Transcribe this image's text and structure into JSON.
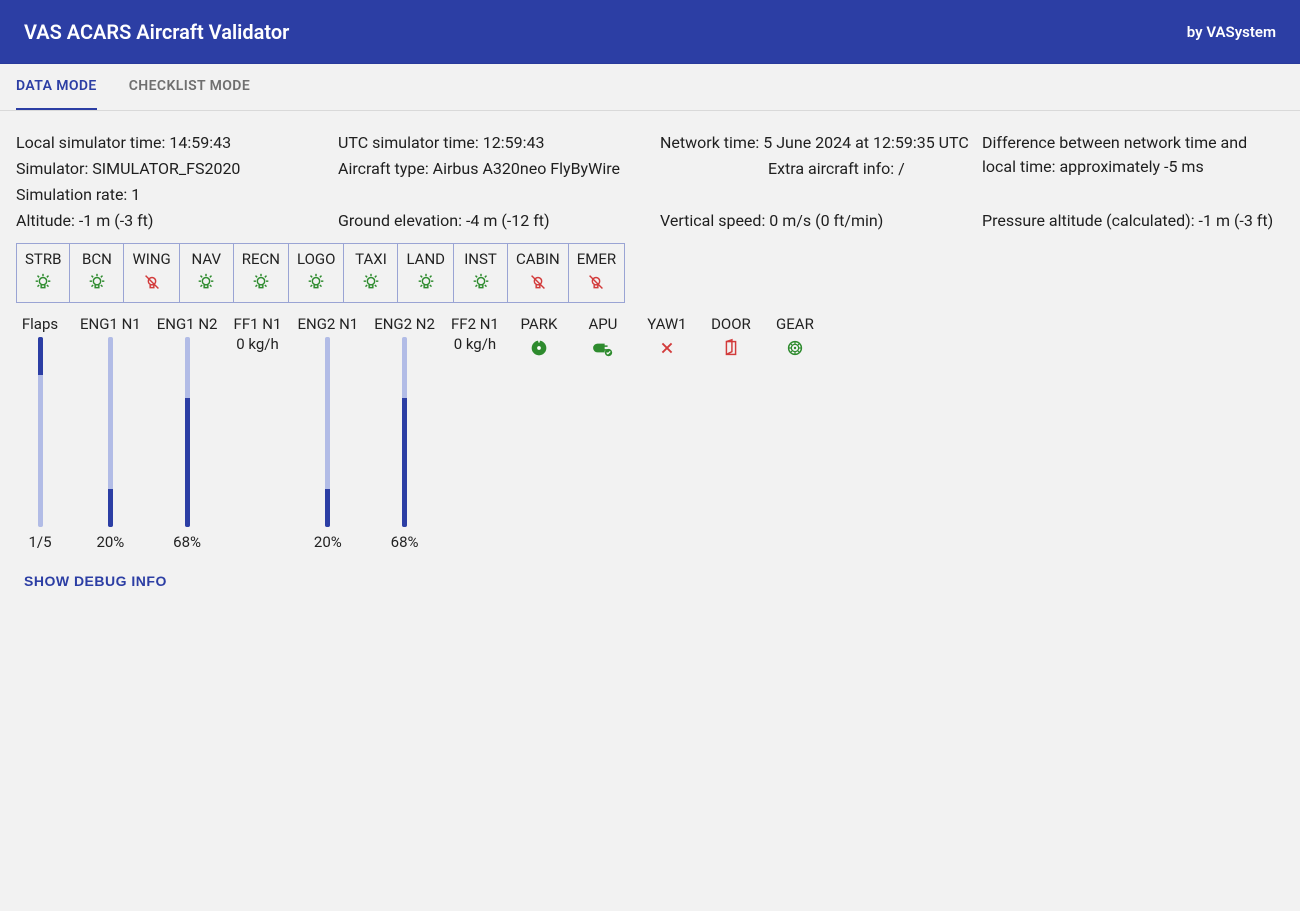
{
  "header": {
    "title": "VAS ACARS Aircraft Validator",
    "byline": "by VASystem"
  },
  "tabs": {
    "data": "DATA MODE",
    "checklist": "CHECKLIST MODE",
    "active": "data"
  },
  "info": {
    "localSimTime": "Local simulator time: 14:59:43",
    "utcSimTime": "UTC simulator time: 12:59:43",
    "networkTime": "Network time: 5 June 2024 at 12:59:35 UTC",
    "timeDiff": "Difference between network time and local time: approximately -5 ms",
    "simulator": "Simulator: SIMULATOR_FS2020",
    "aircraftType": "Aircraft type: Airbus A320neo FlyByWire",
    "extraInfo": "Extra aircraft info: /",
    "simRate": "Simulation rate: 1",
    "altitude": "Altitude: -1 m (-3 ft)",
    "groundElev": "Ground elevation: -4 m (-12 ft)",
    "verticalSpeed": "Vertical speed: 0 m/s (0 ft/min)",
    "pressureAlt": "Pressure altitude (calculated): -1 m (-3 ft)"
  },
  "lights": [
    {
      "name": "STRB",
      "on": true
    },
    {
      "name": "BCN",
      "on": true
    },
    {
      "name": "WING",
      "on": false
    },
    {
      "name": "NAV",
      "on": true
    },
    {
      "name": "RECN",
      "on": true
    },
    {
      "name": "LOGO",
      "on": true
    },
    {
      "name": "TAXI",
      "on": true
    },
    {
      "name": "LAND",
      "on": true
    },
    {
      "name": "INST",
      "on": true
    },
    {
      "name": "CABIN",
      "on": false
    },
    {
      "name": "EMER",
      "on": false
    }
  ],
  "bars": {
    "flaps": {
      "label": "Flaps",
      "value": "1/5",
      "fillFromTop": true,
      "fillPct": 20
    },
    "eng1n1": {
      "label": "ENG1 N1",
      "value": "20%",
      "fillPct": 20
    },
    "eng1n2": {
      "label": "ENG1 N2",
      "value": "68%",
      "fillPct": 68
    },
    "ff1n1": {
      "label": "FF1 N1",
      "sub": "0 kg/h",
      "kind": "text"
    },
    "eng2n1": {
      "label": "ENG2 N1",
      "value": "20%",
      "fillPct": 20
    },
    "eng2n2": {
      "label": "ENG2 N2",
      "value": "68%",
      "fillPct": 68
    },
    "ff2n1": {
      "label": "FF2 N1",
      "sub": "0 kg/h",
      "kind": "text"
    },
    "park": {
      "label": "PARK",
      "icon": "park-on",
      "kind": "icon"
    },
    "apu": {
      "label": "APU",
      "icon": "plug-ok",
      "kind": "icon"
    },
    "yaw1": {
      "label": "YAW1",
      "icon": "x-off",
      "kind": "icon"
    },
    "door": {
      "label": "DOOR",
      "icon": "door-open",
      "kind": "icon"
    },
    "gear": {
      "label": "GEAR",
      "icon": "gear-down",
      "kind": "icon"
    }
  },
  "buttons": {
    "debug": "SHOW DEBUG INFO"
  },
  "colors": {
    "green": "#2e8b2e",
    "red": "#d23b3b",
    "primary": "#2c3ea4"
  }
}
